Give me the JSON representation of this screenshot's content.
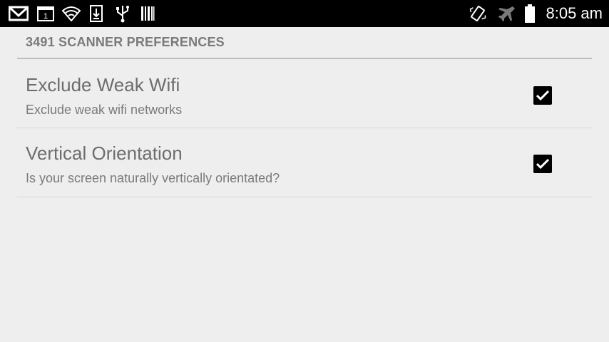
{
  "status_bar": {
    "time": "8:05 am",
    "left_icons": [
      "gmail-icon",
      "calendar-icon",
      "wifi-icon",
      "download-icon",
      "usb-icon",
      "barcode-icon"
    ],
    "right_icons": [
      "vibrate-icon",
      "airplane-icon",
      "battery-icon"
    ],
    "calendar_day": "1"
  },
  "preferences": {
    "category_title": "3491 SCANNER PREFERENCES",
    "items": [
      {
        "title": "Exclude Weak Wifi",
        "summary": "Exclude weak wifi networks",
        "checked": true
      },
      {
        "title": "Vertical Orientation",
        "summary": "Is your screen naturally vertically orientated?",
        "checked": true
      }
    ]
  },
  "colors": {
    "background": "#eeeeee",
    "status_bar": "#000000",
    "header_text": "#7a7a7a",
    "title_text": "#6d6d6d",
    "checkbox": "#000000"
  }
}
